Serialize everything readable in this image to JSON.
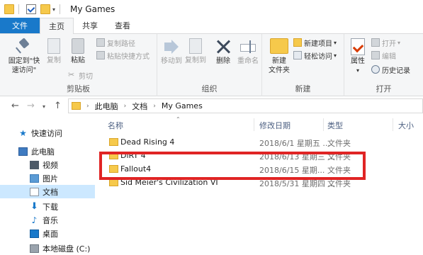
{
  "window": {
    "title": "My Games",
    "qa_dropdown": "▾"
  },
  "tabs": [
    {
      "label": "文件"
    },
    {
      "label": "主页"
    },
    {
      "label": "共享"
    },
    {
      "label": "查看"
    }
  ],
  "ribbon": {
    "clipboard": {
      "label": "剪贴板",
      "pin_label_1": "固定到\"快",
      "pin_label_2": "速访问\"",
      "copy": "复制",
      "paste": "粘贴",
      "copy_path": "复制路径",
      "paste_shortcut": "粘贴快捷方式",
      "cut": "剪切"
    },
    "organize": {
      "label": "组织",
      "move_to": "移动到",
      "copy_to": "复制到",
      "delete": "删除",
      "rename": "重命名"
    },
    "new": {
      "label": "新建",
      "new_folder_1": "新建",
      "new_folder_2": "文件夹",
      "new_item": "新建项目",
      "easy_access": "轻松访问"
    },
    "open": {
      "label": "打开",
      "properties": "属性",
      "open": "打开",
      "edit": "编辑",
      "history": "历史记录"
    }
  },
  "address": {
    "crumbs": [
      "此电脑",
      "文档",
      "My Games"
    ]
  },
  "nav_pane": {
    "items": [
      {
        "label": "快速访问"
      },
      {
        "label": "此电脑"
      },
      {
        "label": "视频"
      },
      {
        "label": "图片"
      },
      {
        "label": "文档"
      },
      {
        "label": "下载"
      },
      {
        "label": "音乐"
      },
      {
        "label": "桌面"
      },
      {
        "label": "本地磁盘 (C:)"
      }
    ]
  },
  "columns": {
    "name": "名称",
    "date": "修改日期",
    "type": "类型",
    "size": "大小"
  },
  "files": [
    {
      "name": "Dead Rising 4",
      "date": "2018/6/1 星期五 ...",
      "type": "文件夹"
    },
    {
      "name": "DiRT 4",
      "date": "2018/6/13 星期三 ...",
      "type": "文件夹"
    },
    {
      "name": "Fallout4",
      "date": "2018/6/15 星期...",
      "type": "文件夹"
    },
    {
      "name": "Sid Meier's Civilization VI",
      "date": "2018/5/31 星期四 ...",
      "type": "文件夹"
    }
  ],
  "colors": {
    "accent": "#1979ca",
    "highlight_box": "#e02424",
    "selected_nav": "#cce8ff"
  }
}
